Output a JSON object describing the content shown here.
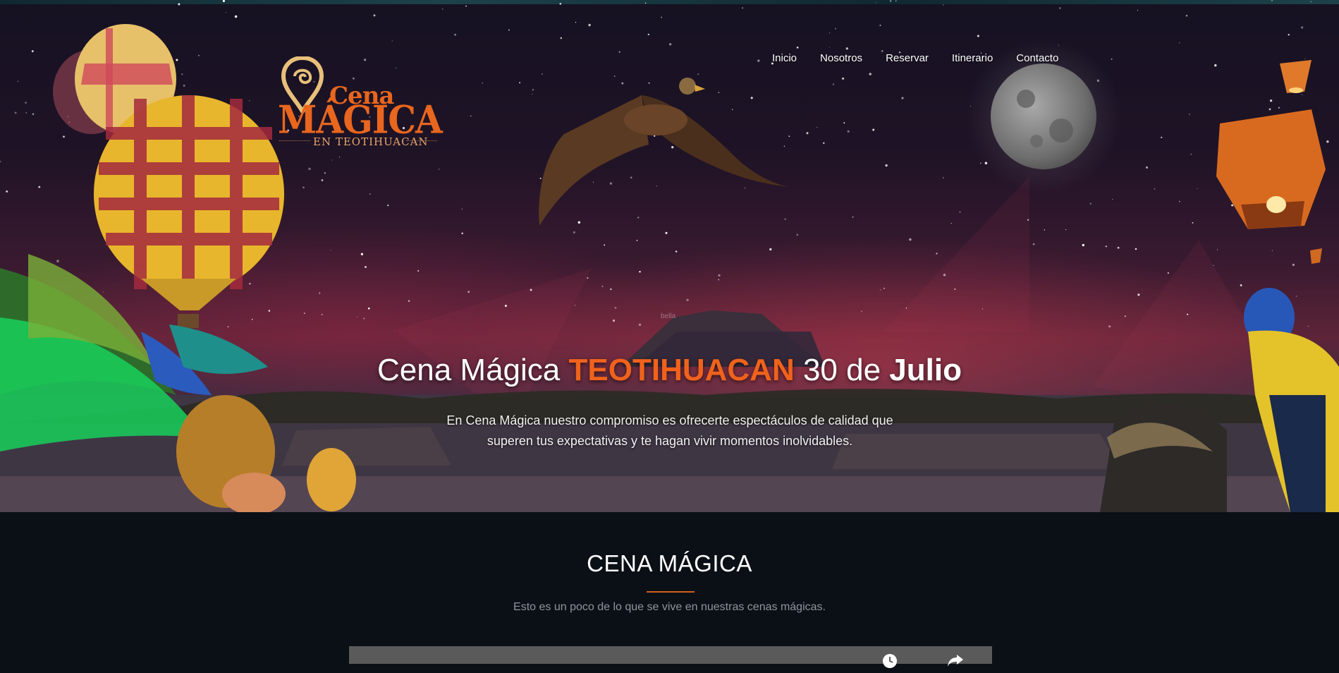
{
  "brand": {
    "logo_top": "Cena",
    "logo_main": "MÁGICA",
    "logo_sub": "EN TEOTIHUACAN",
    "accent_color": "#e8661e"
  },
  "nav": {
    "items": [
      {
        "label": "Inicio"
      },
      {
        "label": "Nosotros"
      },
      {
        "label": "Reservar"
      },
      {
        "label": "Itinerario"
      },
      {
        "label": "Contacto"
      }
    ]
  },
  "hero": {
    "title_part1": "Cena Mágica",
    "title_accent": "TEOTIHUACAN",
    "title_part2": "30 de",
    "title_bold": "Julio",
    "description": "En Cena Mágica nuestro compromiso es ofrecerte espectáculos de calidad que superen tus expectativas y te hagan vivir momentos inolvidables.",
    "small_label": "bella"
  },
  "section": {
    "title": "CENA MÁGICA",
    "subtitle": "Esto es un poco de lo que se vive en nuestras cenas mágicas."
  },
  "video": {
    "icons": [
      "clock-icon",
      "share-icon"
    ]
  }
}
